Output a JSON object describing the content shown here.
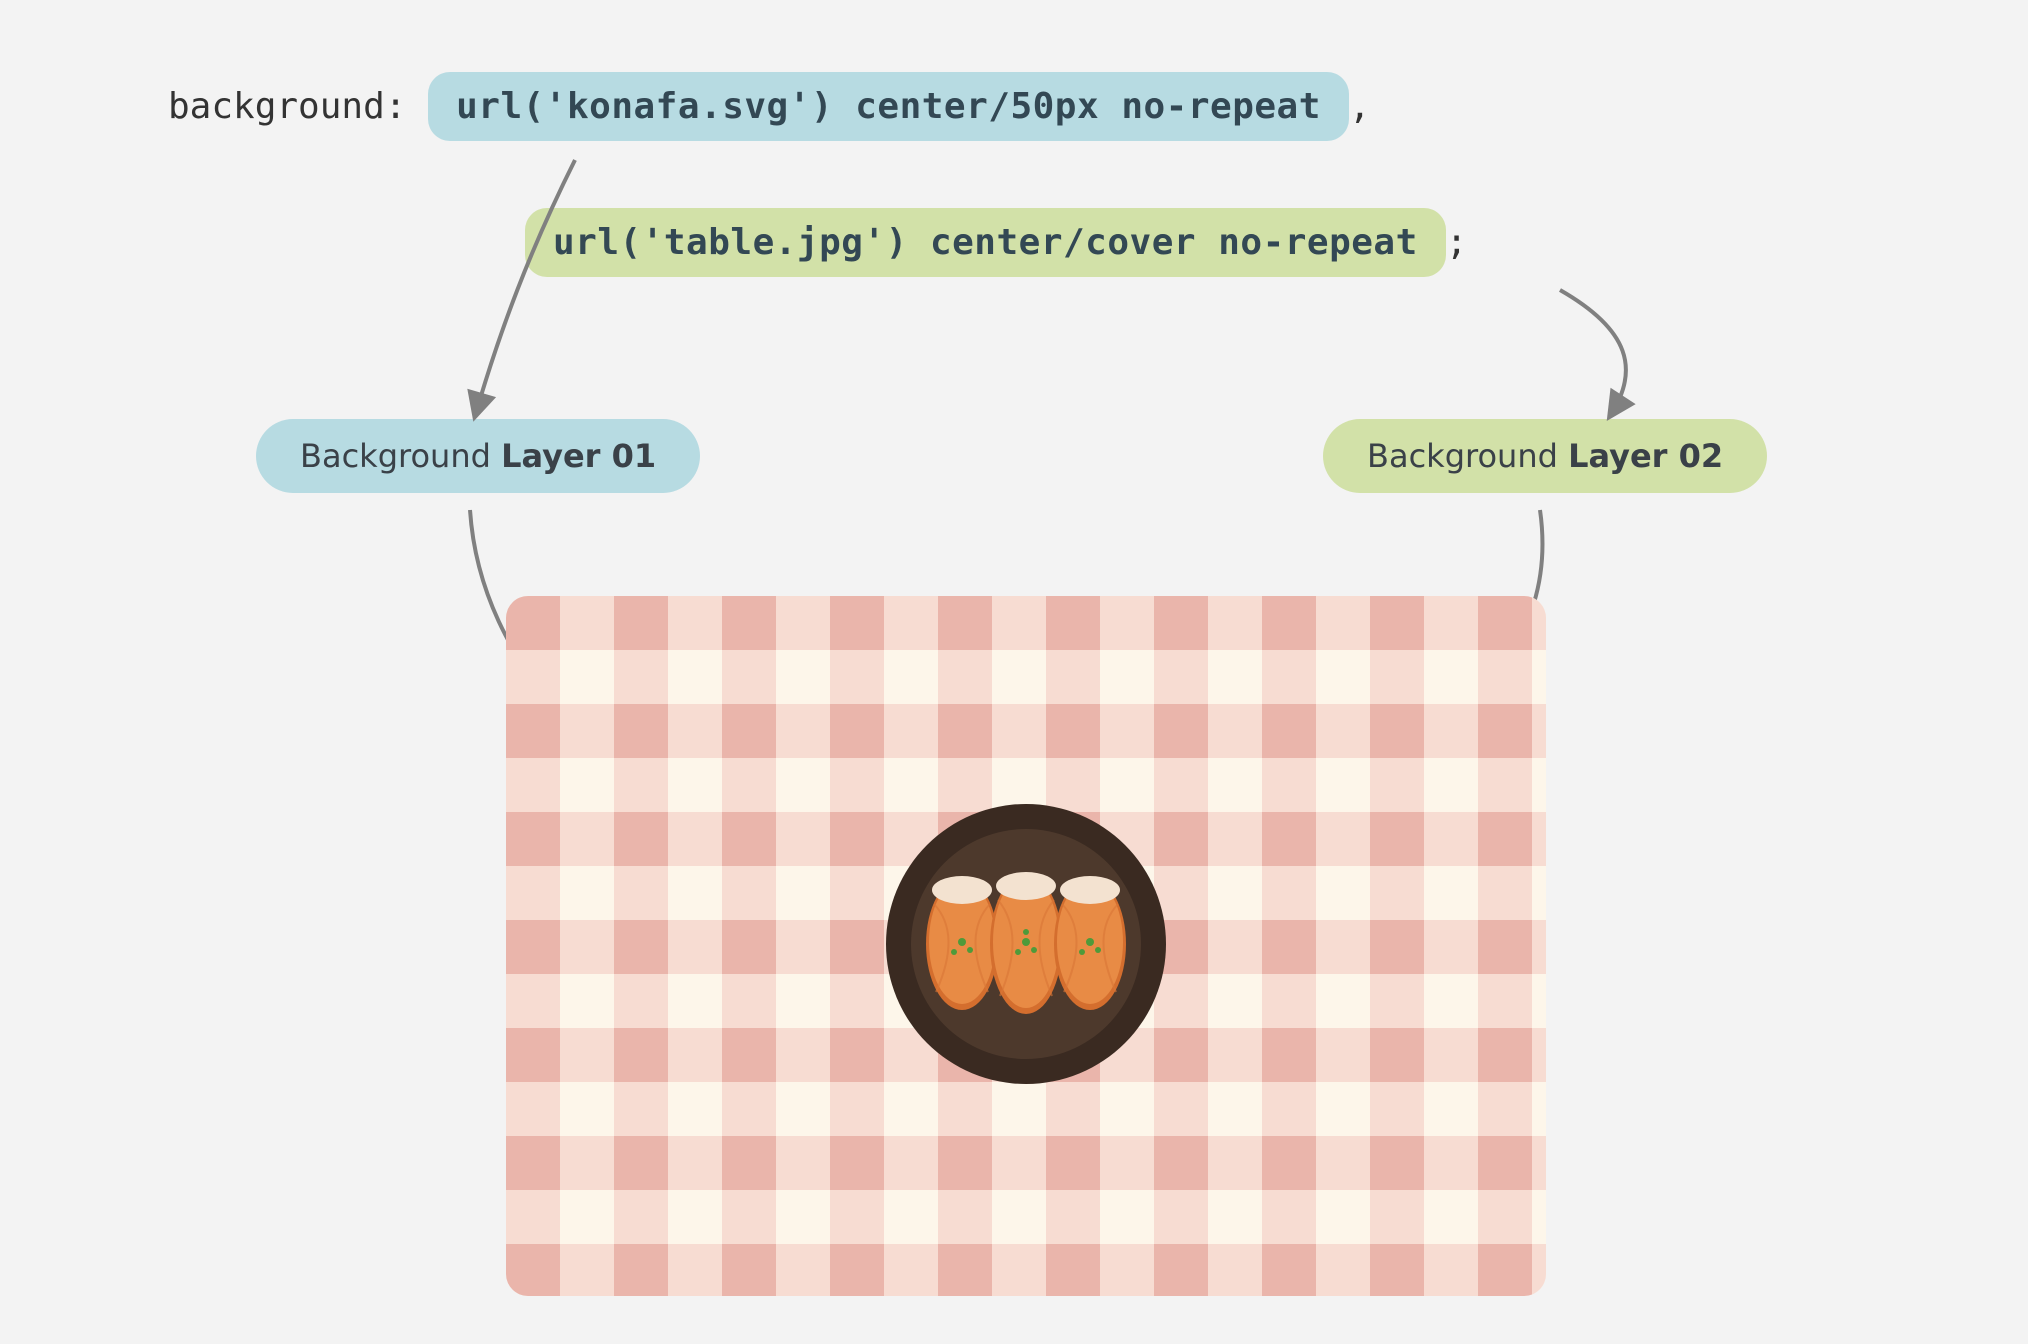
{
  "code": {
    "property": "background:",
    "layer1_value": "url('konafa.svg') center/50px no-repeat",
    "separator": ",",
    "layer2_value": "url('table.jpg') center/cover no-repeat",
    "terminator": ";"
  },
  "labels": {
    "layer1_prefix": "Background ",
    "layer1_bold": "Layer 01",
    "layer2_prefix": "Background ",
    "layer2_bold": "Layer 02"
  },
  "colors": {
    "blue": "#b7dbe2",
    "green": "#d2e1a8",
    "text": "#334854",
    "arrow": "#808080",
    "tablecloth_base": "#fdf6ea",
    "tablecloth_stripe": "#f1c6bd",
    "tablecloth_cross": "#e9b0a6",
    "plate_outer": "#3a2a21",
    "plate_inner": "#4d392c",
    "konafa": "#e88b45",
    "konafa_top": "#f3e2d0",
    "garnish": "#4f9a3a"
  }
}
